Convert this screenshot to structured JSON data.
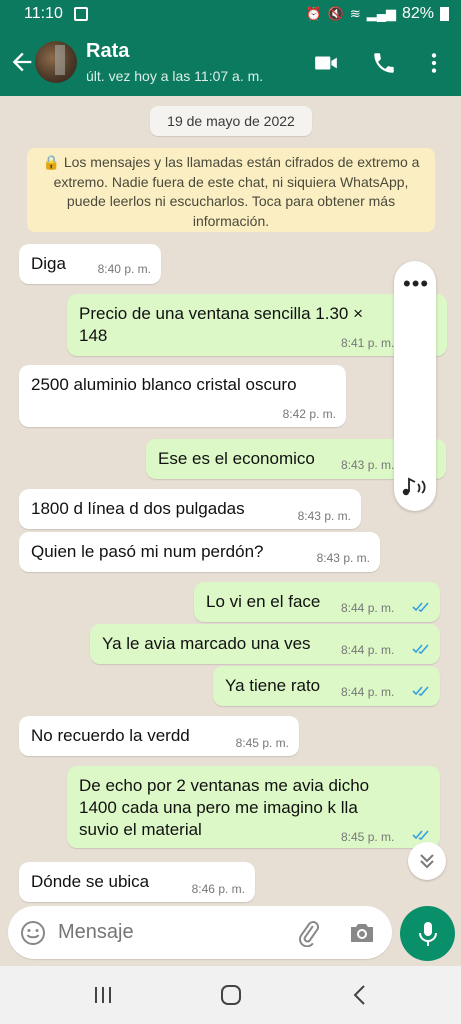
{
  "status": {
    "time": "11:10",
    "battery": "82%"
  },
  "header": {
    "name": "Rata",
    "last_seen": "últ. vez hoy a las 11:07 a. m."
  },
  "chat": {
    "date": "19 de mayo de 2022",
    "encryption_notice": "🔒 Los mensajes y las llamadas están cifrados de extremo a extremo. Nadie fuera de este chat, ni siquiera WhatsApp, puede leerlos ni escucharlos. Toca para obtener más información.",
    "messages": [
      {
        "dir": "in",
        "text": "Diga",
        "time": "8:40 p. m."
      },
      {
        "dir": "out",
        "text": "Precio de una ventana sencilla 1.30 ×\n148",
        "time": "8:41 p. m."
      },
      {
        "dir": "in",
        "text": "2500 aluminio blanco cristal oscuro",
        "time": "8:42 p. m."
      },
      {
        "dir": "out",
        "text": "Ese es el economico",
        "time": "8:43 p. m."
      },
      {
        "dir": "in",
        "text": "1800 d línea d dos pulgadas",
        "time": "8:43 p. m."
      },
      {
        "dir": "in",
        "text": "Quien le pasó mi num perdón?",
        "time": "8:43 p. m."
      },
      {
        "dir": "out",
        "text": "Lo vi en el face",
        "time": "8:44 p. m.",
        "read": true
      },
      {
        "dir": "out",
        "text": "Ya le avia marcado una ves",
        "time": "8:44 p. m.",
        "read": true
      },
      {
        "dir": "out",
        "text": "Ya tiene rato",
        "time": "8:44 p. m.",
        "read": true
      },
      {
        "dir": "in",
        "text": "No recuerdo la verdd",
        "time": "8:45 p. m."
      },
      {
        "dir": "out",
        "text": "De echo por 2 ventanas me avia dicho\n1400 cada una pero me imagino k lla\nsuvio el material",
        "time": "8:45 p. m.",
        "read": true
      },
      {
        "dir": "in",
        "text": "Dónde se ubica",
        "time": "8:46 p. m."
      }
    ]
  },
  "input": {
    "placeholder": "Mensaje"
  },
  "colors": {
    "header": "#0b7a5f",
    "outgoing": "#dcf8c6",
    "incoming": "#ffffff",
    "read_ticks": "#34a0e6",
    "mic": "#0a8f6b"
  }
}
